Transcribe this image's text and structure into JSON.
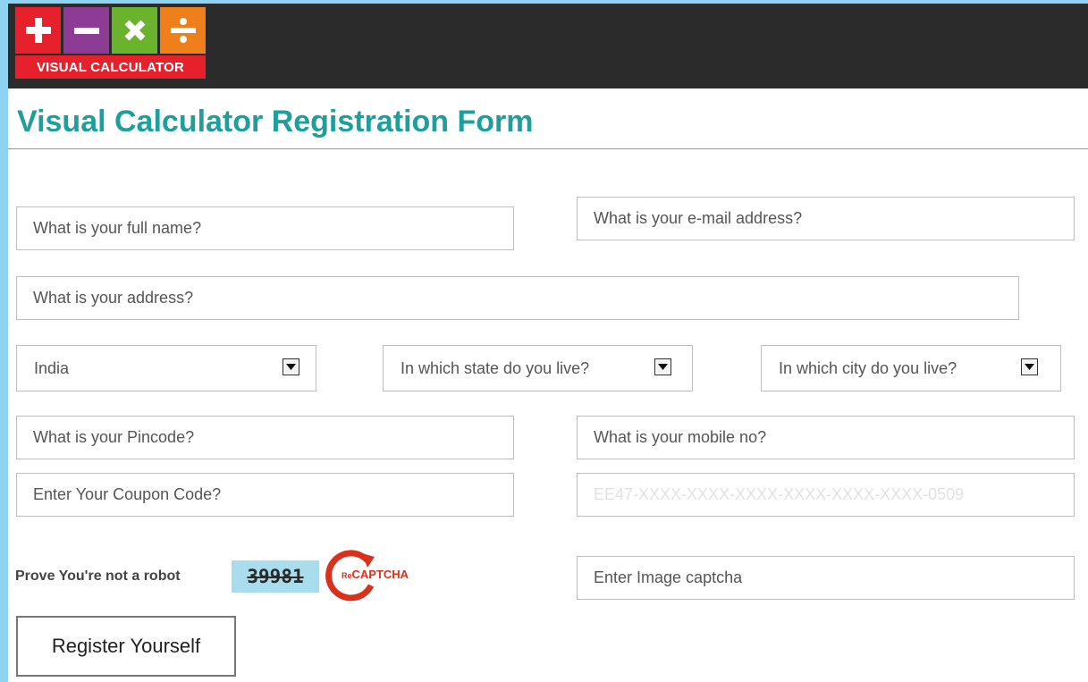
{
  "logo": {
    "banner_text": "VISUAL CALCULATOR",
    "tiles": [
      {
        "icon": "plus-icon",
        "color": "#e6212b"
      },
      {
        "icon": "minus-icon",
        "color": "#8e3b96"
      },
      {
        "icon": "multiply-icon",
        "color": "#6ab42d"
      },
      {
        "icon": "divide-icon",
        "color": "#ef7f1a"
      }
    ]
  },
  "form": {
    "title": "Visual Calculator Registration Form",
    "full_name_placeholder": "What is your full name?",
    "email_placeholder": "What is your e-mail address?",
    "address_placeholder": "What is your address?",
    "country_value": "India",
    "state_placeholder": "In which state do you live?",
    "city_placeholder": "In which city do you live?",
    "pincode_placeholder": "What is your Pincode?",
    "mobile_placeholder": "What is your mobile no?",
    "coupon_placeholder": "Enter Your Coupon Code?",
    "serial_placeholder": "EE47-XXXX-XXXX-XXXX-XXXX-XXXX-XXXX-0509",
    "robot_label": "Prove You're not a robot",
    "captcha_code": "39981",
    "recaptcha_prefix": "Re",
    "recaptcha_text": "CAPTCHA",
    "captcha_input_placeholder": "Enter Image captcha",
    "register_label": "Register Yourself"
  },
  "colors": {
    "accent": "#1f9e9c",
    "topbar": "#2b2b2b",
    "captcha_bg": "#a9dced",
    "recaptcha": "#d9311c"
  }
}
